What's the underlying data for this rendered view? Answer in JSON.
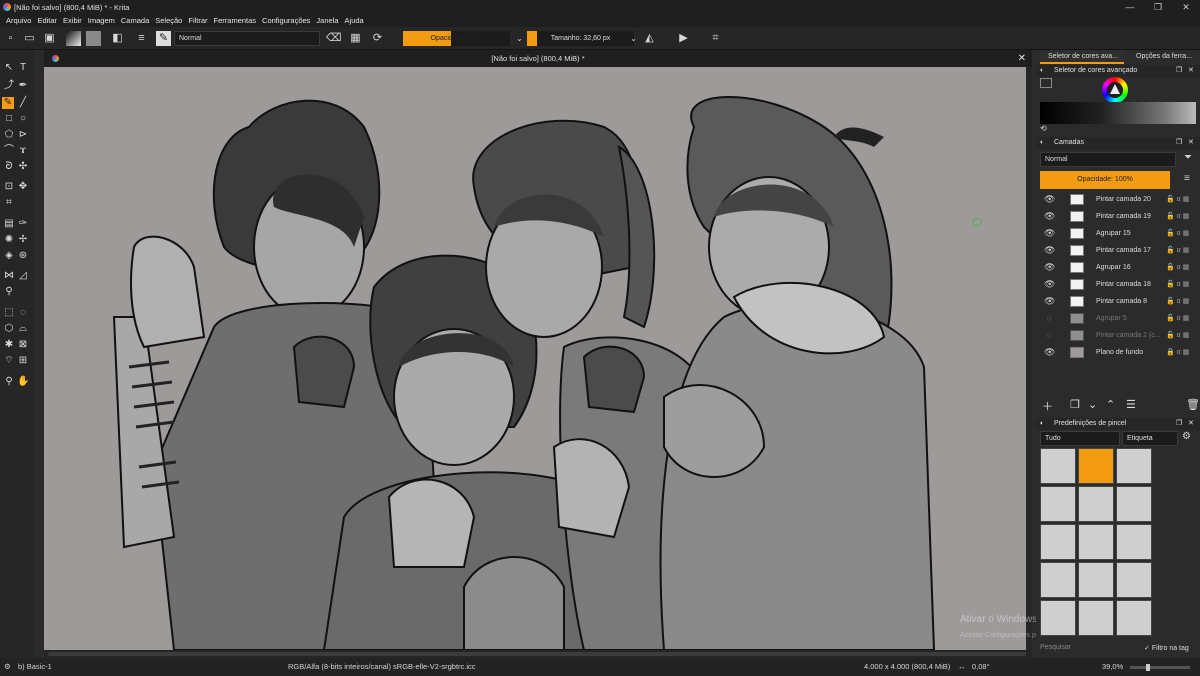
{
  "window": {
    "title": "[Não foi salvo]  (800,4 MiB) * - Krita",
    "controls": [
      "—",
      "❐",
      "✕"
    ]
  },
  "menu": [
    "Arquivo",
    "Editar",
    "Exibir",
    "Imagem",
    "Camada",
    "Seleção",
    "Filtrar",
    "Ferramentas",
    "Configurações",
    "Janela",
    "Ajuda"
  ],
  "toolbar": {
    "blend_mode": "Normal",
    "opacity_label": "Opacidade: 45%",
    "opacity_value": 45,
    "size_label": "Tamanho: 32,60 px",
    "size_value": 32.6
  },
  "document": {
    "tab_title": "[Não foi salvo]  (800,4 MiB) *"
  },
  "right_panel": {
    "tabs": [
      "Seletor de cores ava...",
      "Opções da ferra..."
    ],
    "color_selector_title": "Seletor de cores avançado",
    "layers_title": "Camadas",
    "layer_blend": "Normal",
    "layer_opacity_label": "Opacidade:  100%",
    "layers": [
      {
        "name": "Pintar camada 20",
        "visible": true
      },
      {
        "name": "Pintar camada 19",
        "visible": true
      },
      {
        "name": "Agrupar  15",
        "visible": true
      },
      {
        "name": "Pintar camada 17",
        "visible": true
      },
      {
        "name": "Agrupar  16",
        "visible": true
      },
      {
        "name": "Pintar camada 18",
        "visible": true
      },
      {
        "name": "Pintar camada 8",
        "visible": true
      },
      {
        "name": "Agrupar  5",
        "visible": false
      },
      {
        "name": "Pintar camada 2 (c...",
        "visible": false
      },
      {
        "name": "Plano de fundo",
        "visible": true
      }
    ],
    "brush_presets_title": "Predefinições de pincel",
    "brush_filter": "Tudo",
    "brush_tag": "Etiqueta",
    "search_placeholder": "Pesquisar",
    "filter_by_tag": "Filtro na tag"
  },
  "watermark": {
    "line1": "Ativar o Windows",
    "line2": "Acesse Configurações para ativar o Windows."
  },
  "status": {
    "brush": "b) Basic-1",
    "color_space": "RGB/Alfa (8-bits inteiros/canal)  sRGB-elle-V2-srgbtrc.icc",
    "image_size": "4.000 x 4.000 (800,4 MiB)",
    "rotation": "0,08°",
    "zoom": "39,0%"
  },
  "colors": {
    "accent": "#f39c12",
    "canvas_bg": "#9e9a9a",
    "panel_bg": "#2b2b2b"
  }
}
